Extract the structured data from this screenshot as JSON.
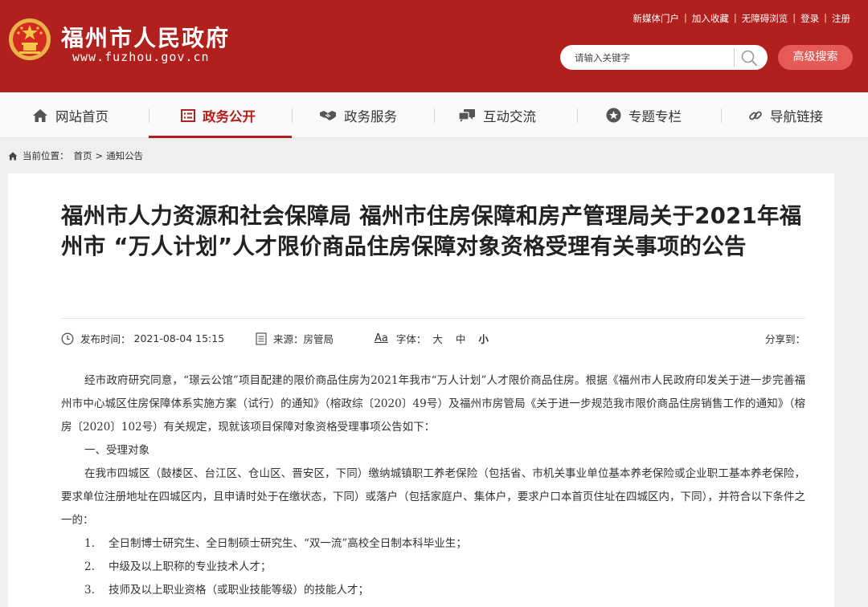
{
  "header": {
    "site_name": "福州市人民政府",
    "site_domain": "www.fuzhou.gov.cn",
    "top_links": [
      "新媒体门户",
      "加入收藏",
      "无障碍浏览",
      "登录",
      "注册"
    ],
    "search_placeholder": "请输入关键字",
    "advanced_search_label": "高级搜索"
  },
  "nav": {
    "items": [
      {
        "label": "网站首页",
        "icon": "home-icon"
      },
      {
        "label": "政务公开",
        "icon": "list-icon"
      },
      {
        "label": "政务服务",
        "icon": "handshake-icon"
      },
      {
        "label": "互动交流",
        "icon": "chat-icon"
      },
      {
        "label": "专题专栏",
        "icon": "star-icon"
      },
      {
        "label": "导航链接",
        "icon": "link-icon"
      }
    ],
    "active": "政务公开"
  },
  "breadcrumb": {
    "prefix": "当前位置：",
    "items": [
      "首页",
      "通知公告"
    ],
    "separator": ">"
  },
  "article": {
    "title": "福州市人力资源和社会保障局 福州市住房保障和房产管理局关于2021年福州市 “万人计划”人才限价商品住房保障对象资格受理有关事项的公告",
    "publish_label": "发布时间：",
    "publish_time": "2021-08-04 15:15",
    "source_label": "来源：",
    "source": "房管局",
    "font_label": "字体：",
    "font_sizes": [
      "大",
      "中",
      "小"
    ],
    "share_label": "分享到：",
    "paragraphs": [
      "经市政府研究同意，“璟云公馆”项目配建的限价商品住房为2021年我市“万人计划”人才限价商品住房。根据《福州市人民政府印发关于进一步完善福州市中心城区住房保障体系实施方案（试行）的通知》（榕政综〔2020〕49号）及福州市房管局《关于进一步规范我市限价商品住房销售工作的通知》（榕房〔2020〕102号）有关规定，现就该项目保障对象资格受理事项公告如下：",
      "一、受理对象",
      "在我市四城区（鼓楼区、台江区、仓山区、晋安区，下同）缴纳城镇职工养老保险（包括省、市机关事业单位基本养老保险或企业职工基本养老保险，要求单位注册地址在四城区内，且申请时处于在缴状态，下同）或落户（包括家庭户、集体户，要求户口本首页住址在四城区内，下同），并符合以下条件之一的："
    ],
    "list_items": [
      {
        "num": "1.",
        "text": "全日制博士研究生、全日制硕士研究生、“双一流”高校全日制本科毕业生；"
      },
      {
        "num": "2.",
        "text": "中级及以上职称的专业技术人才；"
      },
      {
        "num": "3.",
        "text": "技师及以上职业资格（或职业技能等级）的技能人才；"
      }
    ]
  }
}
